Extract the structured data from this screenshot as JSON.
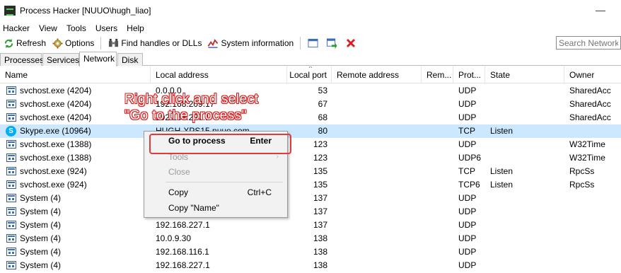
{
  "window": {
    "title": "Process Hacker [NUUO\\hugh_liao]",
    "minimize_glyph": "—"
  },
  "menu": [
    "Hacker",
    "View",
    "Tools",
    "Users",
    "Help"
  ],
  "toolbar": {
    "refresh_label": "Refresh",
    "options_label": "Options",
    "find_label": "Find handles or DLLs",
    "sysinfo_label": "System information",
    "search_placeholder": "Search Network (",
    "icons": [
      "refresh-icon",
      "options-gear-icon",
      "find-handles-icon",
      "system-info-icon",
      "window-icon",
      "go-to-icon",
      "close-x-icon"
    ]
  },
  "tabs": [
    "Processes",
    "Services",
    "Network",
    "Disk"
  ],
  "active_tab": "Network",
  "columns": [
    "Name",
    "Local address",
    "Local port",
    "Remote address",
    "Rem...",
    "Prot...",
    "State",
    "Owner"
  ],
  "rows": [
    {
      "name": "svchost.exe (4204)",
      "local_address": "0.0.0.0",
      "local_port": "53",
      "protocol": "UDP",
      "state": "",
      "owner": "SharedAcc"
    },
    {
      "name": "svchost.exe (4204)",
      "local_address": "192.168.209.17",
      "local_port": "67",
      "protocol": "UDP",
      "state": "",
      "owner": "SharedAcc"
    },
    {
      "name": "svchost.exe (4204)",
      "local_address": "192.168.227.1",
      "local_port": "68",
      "protocol": "UDP",
      "state": "",
      "owner": "SharedAcc"
    },
    {
      "name": "Skype.exe (10964)",
      "local_address": "HUGH-XPS15.nuuo.com",
      "local_port": "80",
      "protocol": "TCP",
      "state": "Listen",
      "owner": ""
    },
    {
      "name": "svchost.exe (1388)",
      "local_address": "",
      "local_port": "123",
      "protocol": "UDP",
      "state": "",
      "owner": "W32Time"
    },
    {
      "name": "svchost.exe (1388)",
      "local_address": "",
      "local_port": "123",
      "protocol": "UDP6",
      "state": "",
      "owner": "W32Time"
    },
    {
      "name": "svchost.exe (924)",
      "local_address": "",
      "local_port": "135",
      "protocol": "TCP",
      "state": "Listen",
      "owner": "RpcSs"
    },
    {
      "name": "svchost.exe (924)",
      "local_address": "",
      "local_port": "135",
      "protocol": "TCP6",
      "state": "Listen",
      "owner": "RpcSs"
    },
    {
      "name": "System (4)",
      "local_address": "",
      "local_port": "137",
      "protocol": "UDP",
      "state": "",
      "owner": ""
    },
    {
      "name": "System (4)",
      "local_address": "",
      "local_port": "137",
      "protocol": "UDP",
      "state": "",
      "owner": ""
    },
    {
      "name": "System (4)",
      "local_address": "192.168.227.1",
      "local_port": "137",
      "protocol": "UDP",
      "state": "",
      "owner": ""
    },
    {
      "name": "System (4)",
      "local_address": "10.0.9.30",
      "local_port": "138",
      "protocol": "UDP",
      "state": "",
      "owner": ""
    },
    {
      "name": "System (4)",
      "local_address": "192.168.116.1",
      "local_port": "138",
      "protocol": "UDP",
      "state": "",
      "owner": ""
    },
    {
      "name": "System (4)",
      "local_address": "192.168.227.1",
      "local_port": "138",
      "protocol": "UDP",
      "state": "",
      "owner": ""
    }
  ],
  "selected_row": 3,
  "context_menu": {
    "go_to": {
      "label": "Go to process",
      "shortcut": "Enter"
    },
    "tools": {
      "label": "Tools"
    },
    "close": {
      "label": "Close"
    },
    "copy": {
      "label": "Copy",
      "shortcut": "Ctrl+C"
    },
    "copy_name": {
      "label": "Copy \"Name\""
    }
  },
  "annotation": {
    "line1": "Right click and select",
    "line2": "\"Go to the process\"",
    "color": "#d81c1c"
  }
}
